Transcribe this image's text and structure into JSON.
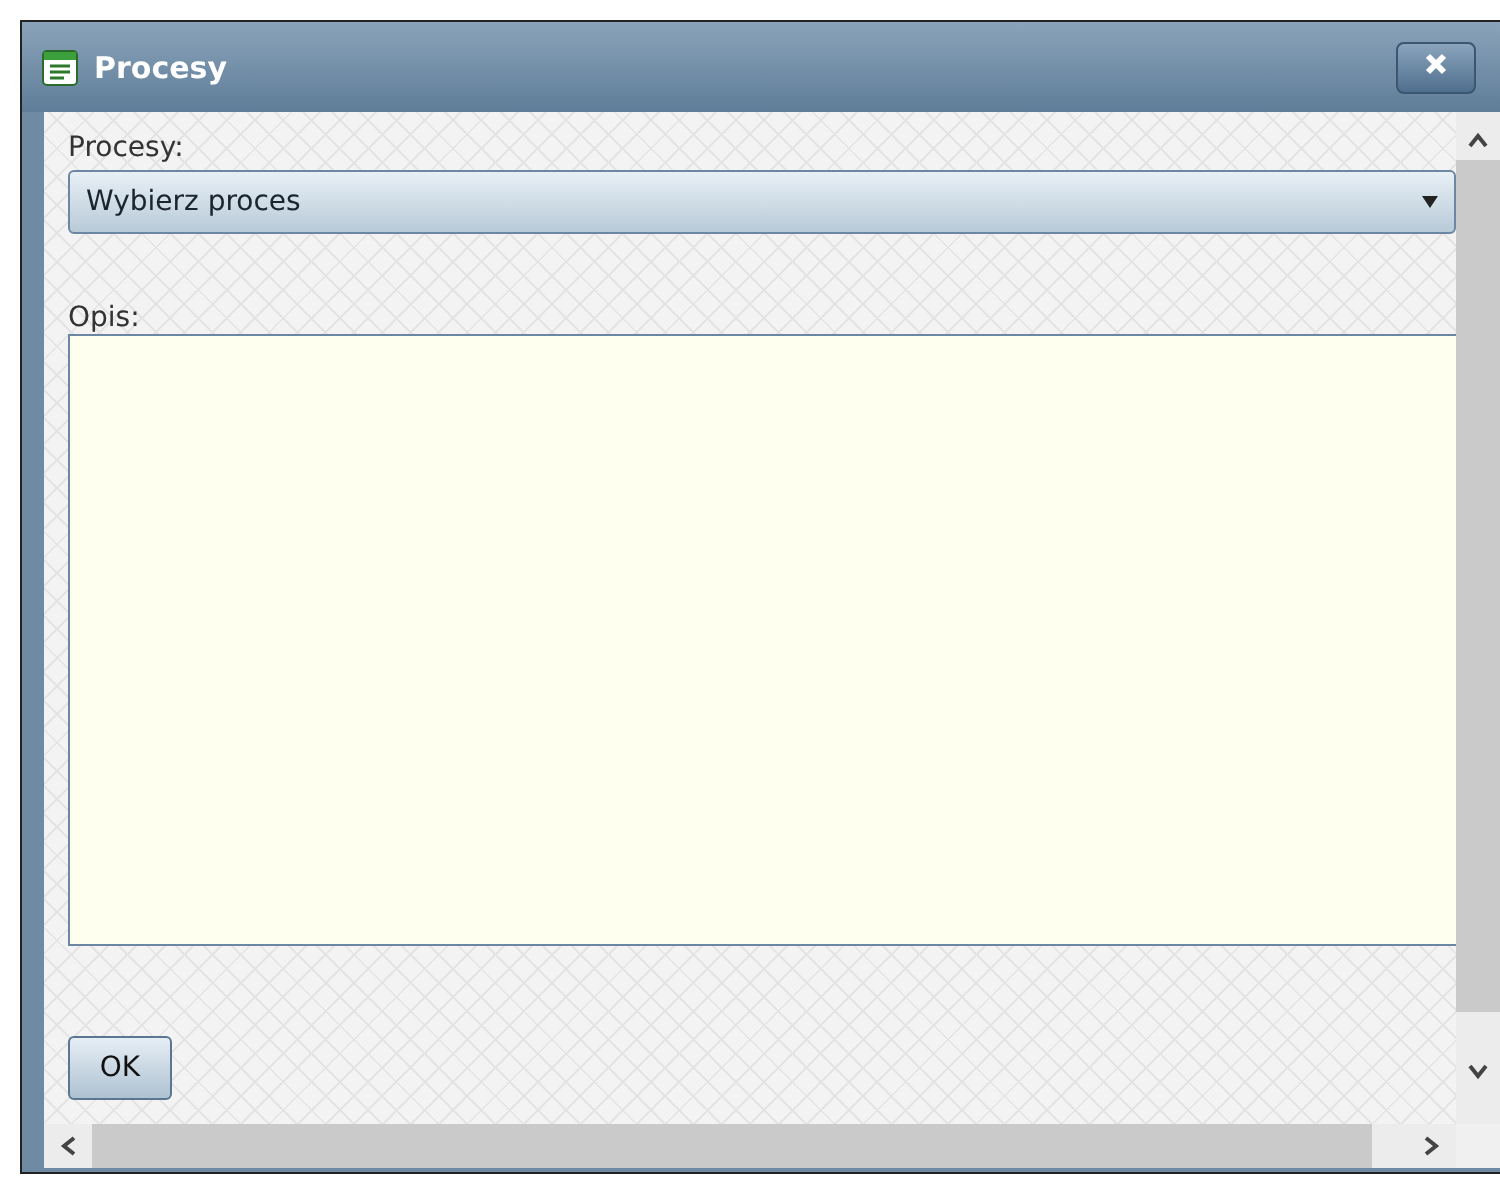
{
  "window": {
    "title": "Procesy"
  },
  "process": {
    "label": "Procesy:",
    "value": "Wybierz proces"
  },
  "description": {
    "label": "Opis:"
  },
  "buttons": [
    "OK"
  ]
}
